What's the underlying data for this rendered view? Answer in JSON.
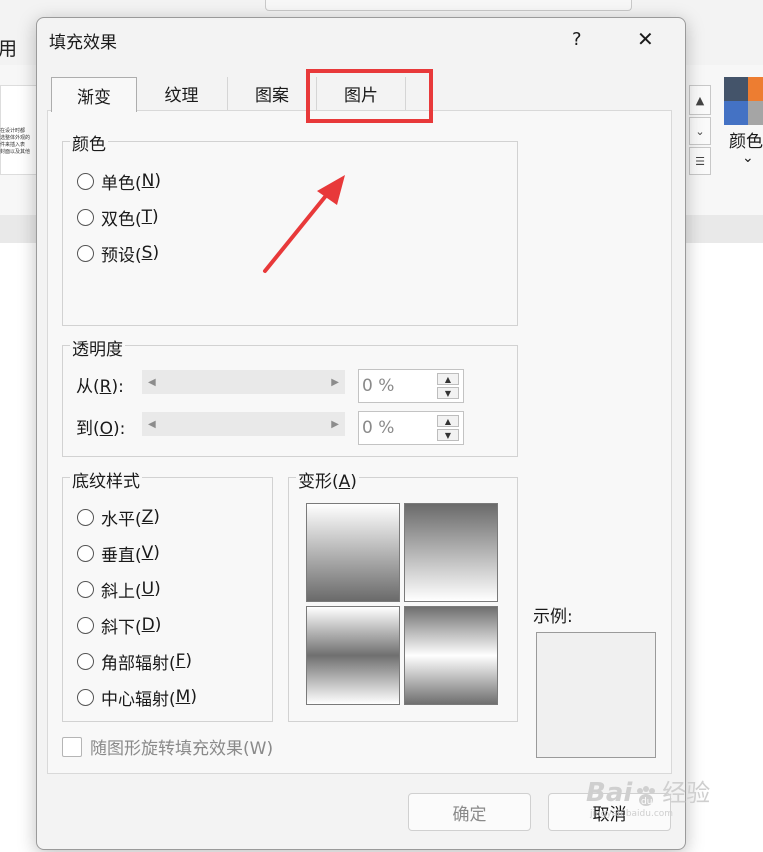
{
  "background": {
    "top_left_char": "用",
    "thumb_text": "在设计时都 选整体外观的 件来插入表 封面以及其他",
    "color_label": "颜色",
    "chevron": "⌄"
  },
  "dialog": {
    "title": "填充效果",
    "help": "?",
    "close": "✕",
    "tabs": [
      "渐变",
      "纹理",
      "图案",
      "图片"
    ],
    "colors": {
      "label": "颜色",
      "options": [
        {
          "text": "单色(",
          "key": "N",
          "end": ")"
        },
        {
          "text": "双色(",
          "key": "T",
          "end": ")"
        },
        {
          "text": "预设(",
          "key": "S",
          "end": ")"
        }
      ]
    },
    "transparency": {
      "label": "透明度",
      "from_text": "从(",
      "from_key": "R",
      "from_end": "):",
      "to_text": "到(",
      "to_key": "O",
      "to_end": "):",
      "from_value": "0 %",
      "to_value": "0 %"
    },
    "shading": {
      "label": "底纹样式",
      "options": [
        {
          "text": "水平(",
          "key": "Z",
          "end": ")"
        },
        {
          "text": "垂直(",
          "key": "V",
          "end": ")"
        },
        {
          "text": "斜上(",
          "key": "U",
          "end": ")"
        },
        {
          "text": "斜下(",
          "key": "D",
          "end": ")"
        },
        {
          "text": "角部辐射(",
          "key": "F",
          "end": ")"
        },
        {
          "text": "中心辐射(",
          "key": "M",
          "end": ")"
        }
      ]
    },
    "variants": {
      "label": "变形(",
      "key": "A",
      "end": ")"
    },
    "sample": {
      "label": "示例:"
    },
    "rotate_checkbox": "随图形旋转填充效果(W)",
    "ok": "确定",
    "cancel": "取消"
  },
  "accent": "#e8393a",
  "watermark": {
    "brand": "Bai",
    "suffix": "经验",
    "sub": "jingyan.baidu.com"
  }
}
